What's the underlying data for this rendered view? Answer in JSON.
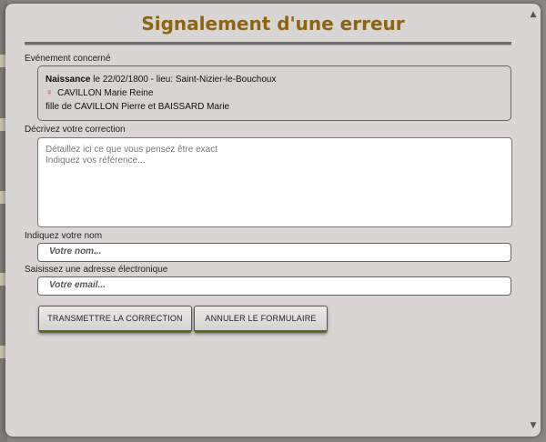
{
  "modal": {
    "title": "Signalement d'une erreur",
    "event": {
      "section_label": "Evénement concerné",
      "type": "Naissance",
      "details": "le 22/02/1800 - lieu: Saint-Nizier-le-Bouchoux",
      "person_name": "CAVILLON Marie Reine",
      "person_icon": "female-icon",
      "parents": "fille de CAVILLON Pierre et BAISSARD Marie"
    },
    "correction": {
      "label": "Décrivez votre correction",
      "placeholder": "Détaillez ici ce que vous pensez être exact\nIndiquez vos référence..."
    },
    "name_field": {
      "label": "Indiquez votre nom",
      "placeholder": "Votre nom..."
    },
    "email_field": {
      "label": "Saisissez une adresse électronique",
      "placeholder": "Votre email..."
    },
    "buttons": {
      "submit": "TRANSMETTRE LA CORRECTION",
      "cancel": "ANNULER LE FORMULAIRE"
    },
    "colors": {
      "title": "#8b6414",
      "background": "#d8d5d4",
      "button_accent": "#5b6b1c",
      "female_icon": "#d4264b"
    }
  }
}
